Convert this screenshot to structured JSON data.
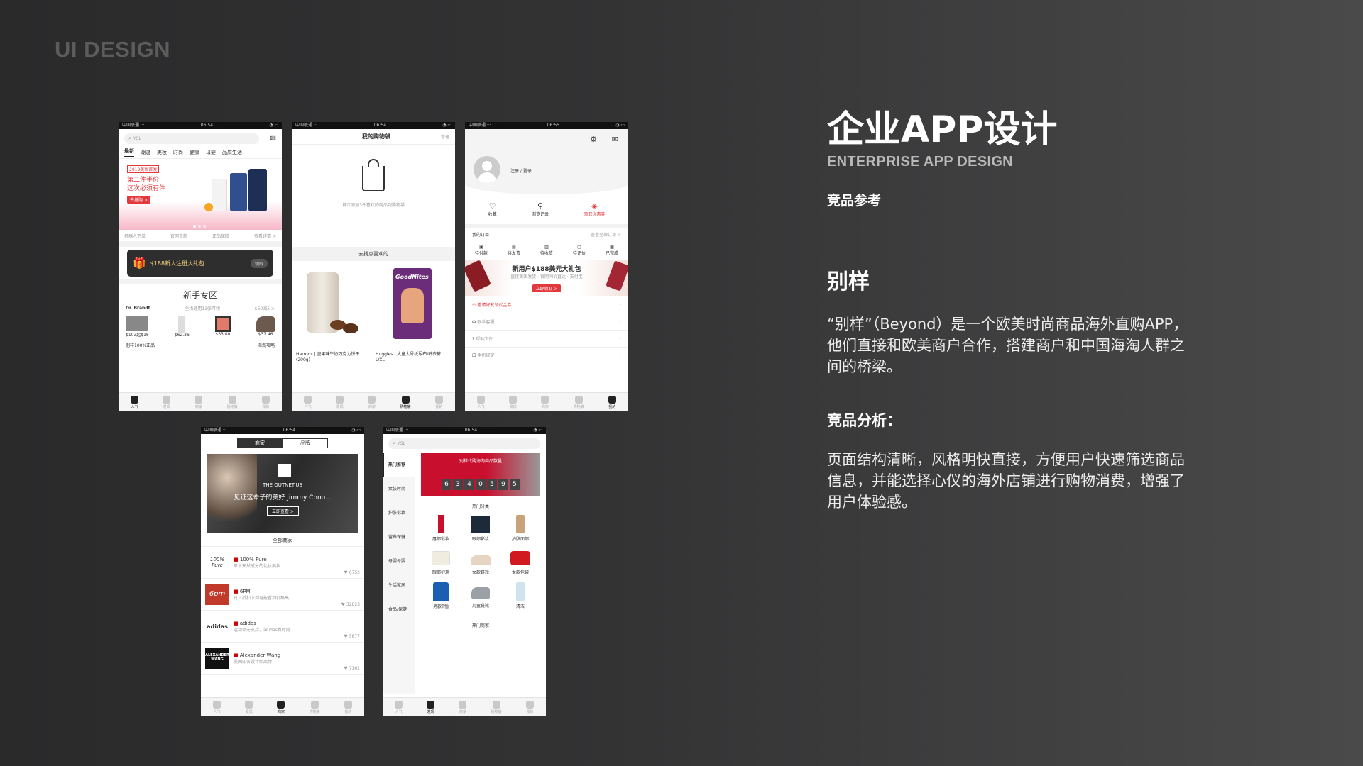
{
  "brand": "UI DESIGN",
  "title": "企业APP设计",
  "subtitle": "ENTERPRISE APP DESIGN",
  "ref_label": "竞品参考",
  "app_name": "别样",
  "intro": "“别样”（Beyond）是一个欧美时尚商品海外直购APP，他们直接和欧美商户合作，搭建商户和中国海淘人群之间的桥梁。",
  "analysis_title": "竞品分析：",
  "analysis_text": "页面结构清晰，风格明快直接，方便用户快速筛选商品信息，并能选择心仪的海外店铺进行购物消费，增强了用户体验感。",
  "colors": {
    "accent": "#e4393c",
    "pink": "#f7b8c8",
    "dark": "#222222"
  },
  "tabbar": {
    "labels": [
      "人气",
      "发现",
      "商家",
      "购物袋",
      "我的"
    ],
    "icons": [
      "home-icon",
      "compass-icon",
      "store-icon",
      "bag-icon",
      "user-icon"
    ]
  },
  "p1": {
    "time": "06:54",
    "search_placeholder": "YSL",
    "categories": [
      "最新",
      "潮流",
      "美妆",
      "时尚",
      "健康",
      "母婴",
      "品质生活"
    ],
    "banner_tag": "2019美妆首发",
    "banner_line1": "第二件半价",
    "banner_line2": "这次必须有件",
    "banner_btn": "去抢购 >",
    "trust": [
      "机器人下单",
      "官网直邮",
      "正品保障",
      "查看详情 >"
    ],
    "gift_text": "$188新人注册大礼包",
    "gift_btn": "领取",
    "newbie_title": "新手专区",
    "brand_name": "Dr. Brandt",
    "brand_desc": "全场通用11张可领",
    "brand_more": "$50减5 >",
    "prices": [
      "$103起$16",
      "$62.36",
      "$33.00",
      "$37.46"
    ],
    "footer_left": "别样100%正品",
    "footer_right": "海淘攻略"
  },
  "p2": {
    "time": "06:54",
    "title": "我的购物袋",
    "edit": "管理",
    "empty_text": "首次添加3件喜欢的商品到购物袋",
    "section": "去找点喜欢的",
    "prod1": "Harrods | 坚果味牛奶巧克力饼干 (200g)",
    "prod2": "Huggies | 大童大号纸尿布/裤衣裤 L/XL",
    "prod2_box": "GoodNites"
  },
  "p3": {
    "time": "06:55",
    "login": "注册 / 登录",
    "quick": [
      "收藏",
      "浏览记录",
      "领取优惠券"
    ],
    "orders_title": "我的订单",
    "orders_more": "查看全部订单 >",
    "orders": [
      "待付款",
      "待发货",
      "待收货",
      "待评价",
      "已完成"
    ],
    "promo": "新用户$188美元大礼包",
    "promo_sub": "直接美国发货 · 官网同价直达 · 支付宝",
    "promo_btn": "立即领取 >",
    "menu": [
      "邀请好友领代金券",
      "联系客服",
      "帮助文件",
      "手机绑定"
    ]
  },
  "p4": {
    "time": "06:54",
    "seg": [
      "商家",
      "品牌"
    ],
    "banner_brand": "THE OUTNET.US",
    "banner_text": "见证这辈子的美好 Jimmy Choo...",
    "banner_btn": "立即查看 >",
    "section": "全部商家",
    "shops": [
      {
        "logo": "100% Pure",
        "name": "100% Pure",
        "desc": "草本天然成分的化妆美妆",
        "likes": "6752"
      },
      {
        "logo": "6pm",
        "name": "6PM",
        "desc": "日日折扣下到可能看到价格高",
        "likes": "32823"
      },
      {
        "logo": "adidas",
        "name": "adidas",
        "desc": "运动单元支持，adidas真时尚",
        "likes": "5877"
      },
      {
        "logo": "ALEXANDER WANG",
        "name": "Alexander Wang",
        "desc": "美国知名设计师品牌",
        "likes": "7162"
      }
    ]
  },
  "p5": {
    "time": "06:54",
    "search_placeholder": "YSL",
    "sidebar": [
      "热门推荐",
      "女装时尚",
      "护肤彩妆",
      "营养保健",
      "母婴母婴",
      "生活家居",
      "食品/保健"
    ],
    "banner_caption": "别样代购海淘商品数量",
    "counter": [
      "6",
      "3",
      "4",
      "0",
      "5",
      "9",
      "5"
    ],
    "hot_title": "热门分类",
    "items": [
      "唇部彩妆",
      "眼部彩妆",
      "护肤面部",
      "眼部护理",
      "女款鞋靴",
      "女款包袋",
      "男款T恤",
      "儿童鞋靴",
      "清洁"
    ],
    "shops_title": "热门商家"
  }
}
